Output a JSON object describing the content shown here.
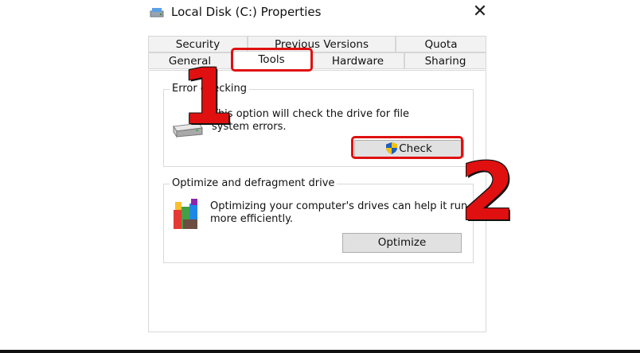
{
  "window": {
    "title": "Local Disk (C:) Properties",
    "close_symbol": "✕"
  },
  "tabs": {
    "row1": [
      "Security",
      "Previous Versions",
      "Quota"
    ],
    "row2": [
      "General",
      "Tools",
      "Hardware",
      "Sharing"
    ],
    "active": "Tools"
  },
  "error_checking": {
    "group_label": "Error checking",
    "description": [
      "This option will check the drive for file",
      "system errors."
    ],
    "button_label": "Check",
    "button_icon": "uac-shield-icon"
  },
  "optimize": {
    "group_label": "Optimize and defragment drive",
    "description": [
      "Optimizing your computer's drives can help it run",
      "more efficiently."
    ],
    "button_label": "Optimize",
    "icon": "defrag-icon"
  },
  "annotations": {
    "step1": "1",
    "step2": "2",
    "color": "#e01010"
  }
}
